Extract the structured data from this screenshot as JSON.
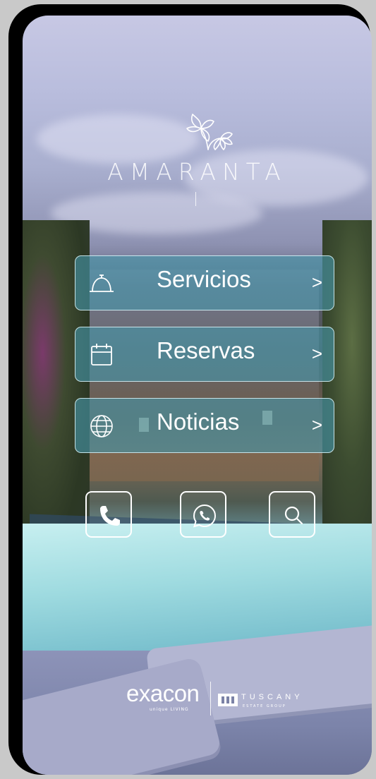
{
  "brand": {
    "name": "AMARANTA"
  },
  "menu": [
    {
      "label": "Servicios",
      "chevron": ">",
      "icon": "bell-icon"
    },
    {
      "label": "Reservas",
      "chevron": ">",
      "icon": "calendar-icon"
    },
    {
      "label": "Noticias",
      "chevron": ">",
      "icon": "globe-icon"
    }
  ],
  "actions": [
    {
      "icon": "phone-icon"
    },
    {
      "icon": "whatsapp-icon"
    },
    {
      "icon": "search-icon"
    }
  ],
  "footer": {
    "partner1": "exacon",
    "partner1_tagline": "unique LIVING",
    "partner2": "TUSCANY",
    "partner2_tagline": "ESTATE GROUP"
  },
  "colors": {
    "button_fill": "#4696aa",
    "button_border": "#dcf5fa",
    "text": "#ffffff"
  }
}
